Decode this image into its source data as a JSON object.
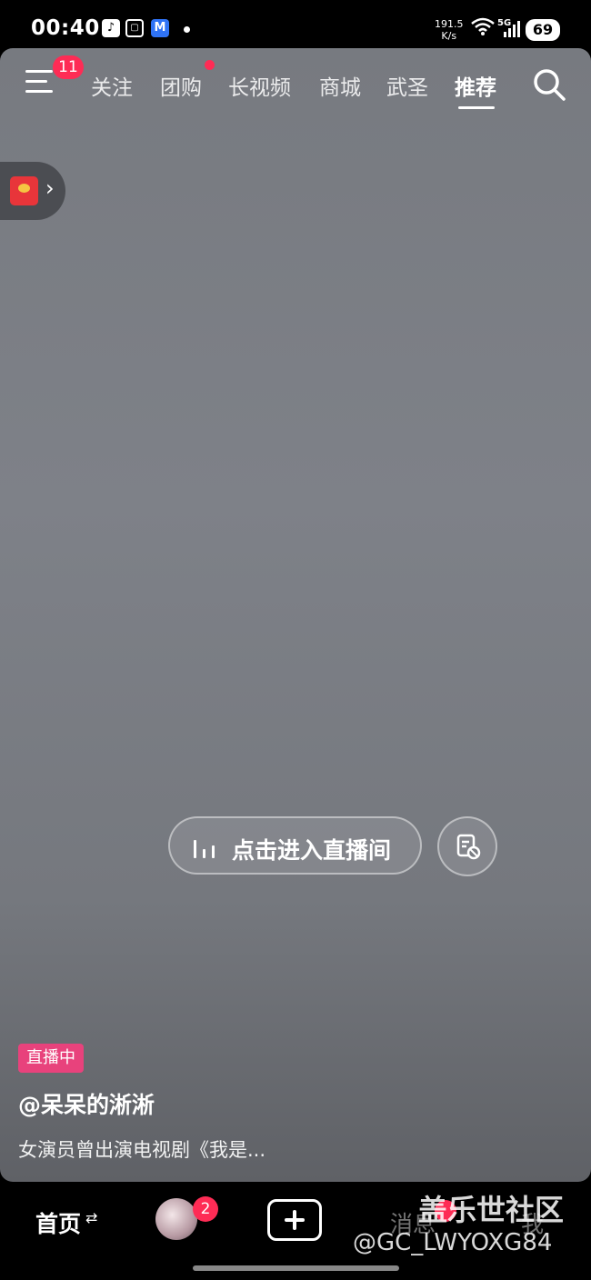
{
  "status_bar": {
    "time": "00:40",
    "net_speed_value": "191.5",
    "net_speed_unit": "K/s",
    "network_type": "5G",
    "battery": "69",
    "app_icons": [
      "tiktok-icon",
      "scan-icon",
      "m-app-icon"
    ]
  },
  "top_nav": {
    "menu_badge": "11",
    "tabs": [
      {
        "label": "关注"
      },
      {
        "label": "团购",
        "has_dot": true
      },
      {
        "label": "长视频"
      },
      {
        "label": "商城"
      },
      {
        "label": "武圣"
      },
      {
        "label": "推荐",
        "active": true
      }
    ],
    "search_icon": "search-icon"
  },
  "red_packet": {
    "icon": "red-packet-icon",
    "arrow": "›"
  },
  "live": {
    "enter_label": "点击进入直播间",
    "badge": "直播中",
    "author": "@呆呆的淅淅",
    "description": "女演员曾出演电视剧《我是..."
  },
  "bottom_nav": {
    "home": "首页",
    "home_switch": "⇄",
    "friends_badge": "2",
    "messages": "消息",
    "me": "我"
  },
  "watermark": {
    "title": "盖乐世社区",
    "handle": "@GC_LWYOXG84"
  },
  "colors": {
    "accent_red": "#fe2c55",
    "live_badge": "#e8427c",
    "card_bg": "#7e8188"
  }
}
